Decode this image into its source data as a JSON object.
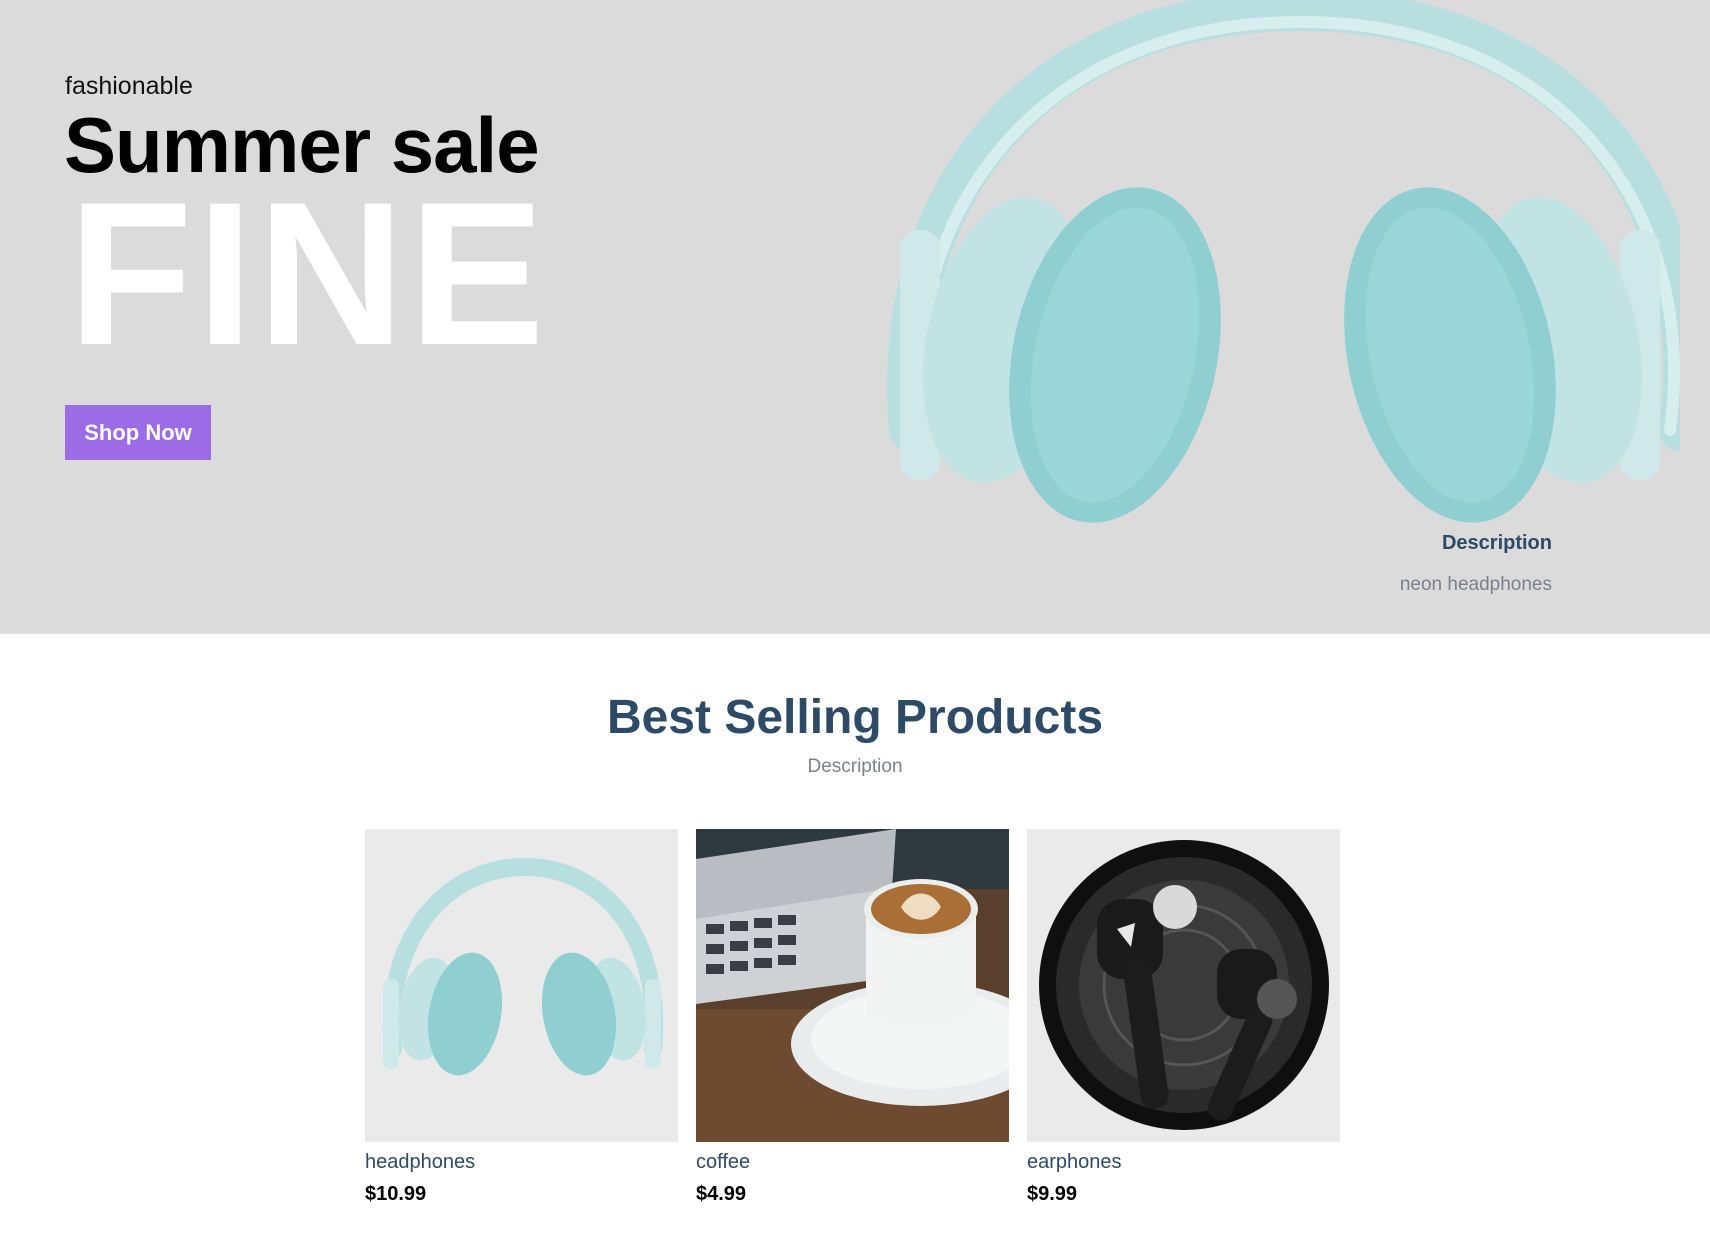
{
  "hero": {
    "eyebrow": "fashionable",
    "title": "Summer sale",
    "big_word": "FINE",
    "cta_label": "Shop Now",
    "description_label": "Description",
    "description_text": "neon headphones",
    "image_icon": "headphones-image",
    "colors": {
      "background": "#dcdbdc",
      "button": "#9b6ce6",
      "accent_text": "#2d4a66"
    }
  },
  "best_selling": {
    "title": "Best Selling Products",
    "subtitle": "Description",
    "products": [
      {
        "name": "headphones",
        "price": "$10.99",
        "image_icon": "headphones-image"
      },
      {
        "name": "coffee",
        "price": "$4.99",
        "image_icon": "coffee-laptop-image"
      },
      {
        "name": "earphones",
        "price": "$9.99",
        "image_icon": "earbuds-image"
      }
    ]
  }
}
